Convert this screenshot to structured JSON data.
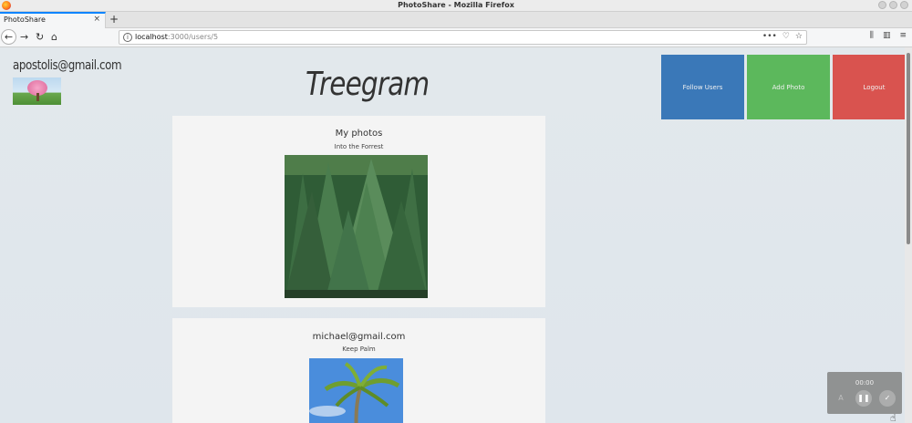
{
  "window": {
    "title": "PhotoShare - Mozilla Firefox"
  },
  "tab": {
    "label": "PhotoShare",
    "close": "×",
    "new_tab": "+"
  },
  "nav": {
    "back": "←",
    "forward": "→",
    "reload": "↻",
    "home": "⌂",
    "url_host": "localhost",
    "url_path": ":3000/users/5",
    "url_tools": "•••",
    "pocket": "♡",
    "bookmark": "☆",
    "library": "⫼",
    "sidebar": "▥",
    "menu": "≡"
  },
  "user": {
    "email": "apostolis@gmail.com"
  },
  "brand": "Treegram",
  "actions": {
    "follow": "Follow Users",
    "add": "Add Photo",
    "logout": "Logout"
  },
  "cards": [
    {
      "title": "My photos",
      "caption": "Into the Forrest"
    },
    {
      "title": "michael@gmail.com",
      "caption": "Keep Palm"
    }
  ],
  "recorder": {
    "time": "00:00",
    "pause": "❚❚",
    "done": "✓",
    "a": "A"
  }
}
